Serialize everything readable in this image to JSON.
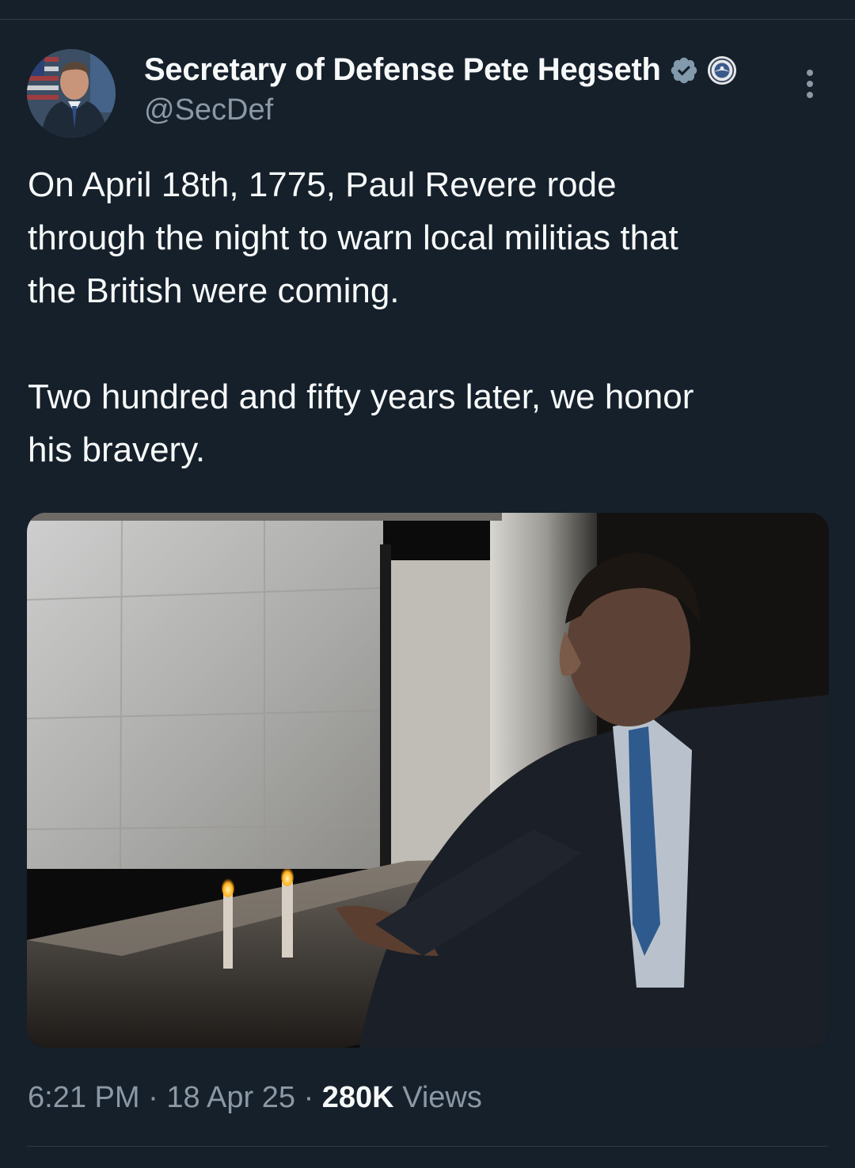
{
  "tweet": {
    "author": {
      "display_name": "Secretary of Defense Pete Hegseth",
      "handle": "@SecDef",
      "verified": true
    },
    "text": "On April 18th, 1775, Paul Revere rode\nthrough the night to warn local militias that\nthe British were coming.\n\nTwo hundred and fifty years later, we honor\nhis bravery.",
    "time": "6:21 PM",
    "separator": "·",
    "date": "18 Apr 25",
    "views_count": "280K",
    "views_label": "Views"
  },
  "icons": {
    "verified": "verified-badge-icon",
    "affiliation": "department-of-defense-seal-icon",
    "more": "more-vertical-icon"
  },
  "colors": {
    "background": "#15202b",
    "text_primary": "#f7f9f9",
    "text_secondary": "#8b98a5",
    "verified_badge": "#829aab"
  }
}
